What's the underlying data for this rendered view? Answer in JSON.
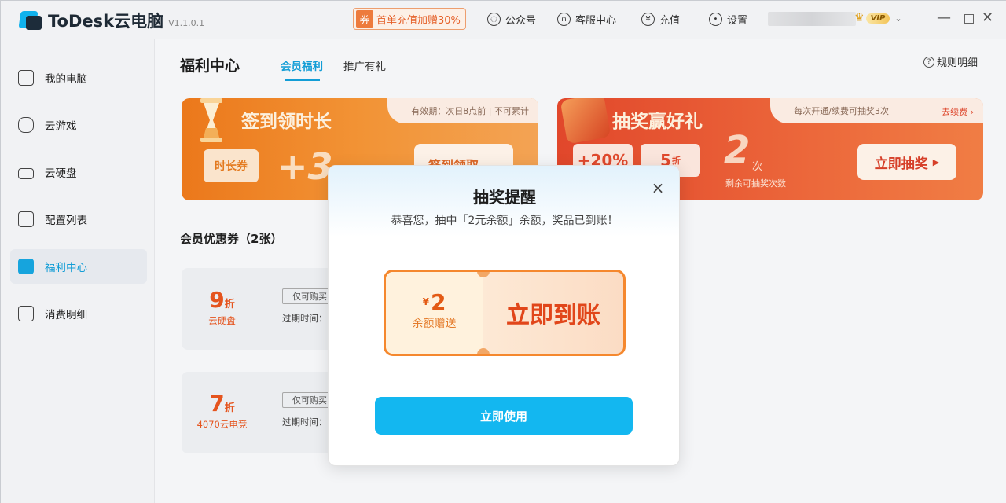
{
  "app": {
    "name": "ToDesk云电脑",
    "version": "V1.1.0.1"
  },
  "titlebar": {
    "promo_tag": "券",
    "promo_text": "首单充值加赠30%",
    "items": [
      {
        "icon": "wechat-icon",
        "label": "公众号"
      },
      {
        "icon": "headset-icon",
        "label": "客服中心"
      },
      {
        "icon": "yen-icon",
        "label": "充值"
      },
      {
        "icon": "gear-icon",
        "label": "设置"
      }
    ],
    "vip_label": "VIP",
    "window_buttons": [
      "minimize-icon",
      "maximize-icon",
      "close-icon"
    ]
  },
  "sidebar": {
    "items": [
      {
        "icon": "monitor-icon",
        "label": "我的电脑",
        "active": false
      },
      {
        "icon": "gamepad-icon",
        "label": "云游戏",
        "active": false
      },
      {
        "icon": "drive-icon",
        "label": "云硬盘",
        "active": false
      },
      {
        "icon": "clipboard-icon",
        "label": "配置列表",
        "active": false
      },
      {
        "icon": "gift-icon",
        "label": "福利中心",
        "active": true
      },
      {
        "icon": "receipt-icon",
        "label": "消费明细",
        "active": false
      }
    ]
  },
  "main": {
    "title": "福利中心",
    "tabs": [
      {
        "label": "会员福利",
        "active": true
      },
      {
        "label": "推广有礼",
        "active": false
      }
    ],
    "rules_label": "规则明细",
    "banner_checkin": {
      "title": "签到领时长",
      "note": "有效期：次日8点前 | 不可累计",
      "coupon_label": "时长券",
      "bonus": "+3",
      "button": "签到领取"
    },
    "banner_lottery": {
      "title": "抽奖赢好礼",
      "note": "每次开通/续费可抽奖3次",
      "renew_link": "去续费",
      "chip1": "+20%",
      "chip2": "5",
      "chip2_unit": "折",
      "remaining_count": "2",
      "remaining_unit": "次",
      "remaining_label": "剩余可抽奖次数",
      "button": "立即抽奖"
    },
    "coupons_title": "会员优惠券（2张）",
    "coupons": [
      {
        "discount": "9",
        "unit": "折",
        "target": "云硬盘",
        "limit": "仅可购买",
        "expiry": "过期时间："
      },
      {
        "discount": "7",
        "unit": "折",
        "target": "4070云电竞",
        "limit": "仅可购买",
        "expiry": "过期时间："
      }
    ]
  },
  "modal": {
    "title": "抽奖提醒",
    "message": "恭喜您，抽中「2元余额」余额，奖品已到账！",
    "prize_currency": "¥",
    "prize_amount": "2",
    "prize_desc": "余额赠送",
    "prize_status": "立即到账",
    "button": "立即使用"
  }
}
